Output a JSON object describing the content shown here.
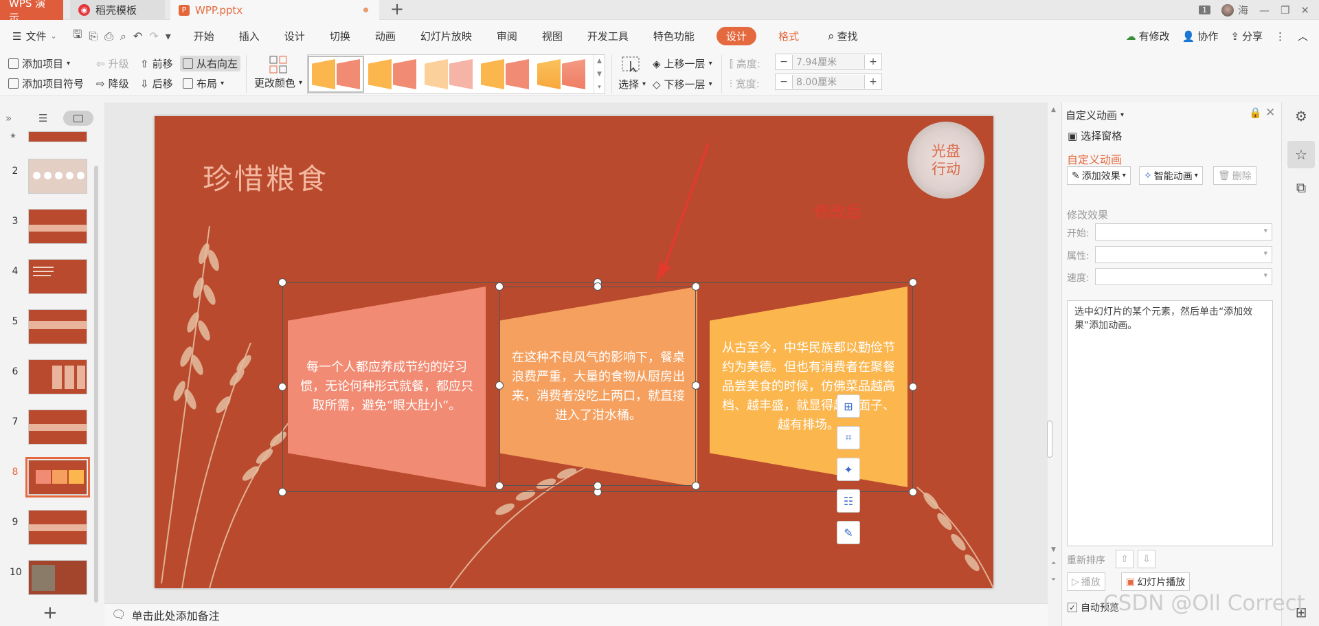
{
  "tabs": {
    "wps": "WPS 演示",
    "daoke": "稻壳模板",
    "ppt": "WPP.pptx",
    "daoke_icon": "daoke-logo-icon",
    "ppt_icon": "ppt-file-icon"
  },
  "titlebar": {
    "page_badge": "1",
    "user": "海"
  },
  "menu": {
    "file": "文件",
    "items": [
      "开始",
      "插入",
      "设计",
      "切换",
      "动画",
      "幻灯片放映",
      "审阅",
      "视图",
      "开发工具",
      "特色功能"
    ],
    "design_pill": "设计",
    "format": "格式",
    "search": "查找",
    "right": {
      "changes": "有修改",
      "collab": "协作",
      "share": "分享"
    }
  },
  "ribbon": {
    "add_item": "添加项目",
    "add_item_symbol": "添加项目符号",
    "upgrade": "升级",
    "downgrade": "降级",
    "forward": "前移",
    "backward": "后移",
    "rtl": "从右向左",
    "layout": "布局",
    "change_color": "更改颜色",
    "select": "选择",
    "up_layer": "上移一层",
    "down_layer": "下移一层",
    "height_label": "高度:",
    "height_value": "7.94厘米",
    "width_label": "宽度:",
    "width_value": "8.00厘米"
  },
  "slides": {
    "numbers": [
      "2",
      "3",
      "4",
      "5",
      "6",
      "7",
      "8",
      "9",
      "10"
    ],
    "selected": "8"
  },
  "slide": {
    "title": "珍惜粮食",
    "seal": "光盘行动",
    "annotation": "修改后",
    "box1": "每一个人都应养成节约的好习惯，无论何种形式就餐，都应只取所需，避免“眼大肚小”。",
    "box2": "在这种不良风气的影响下，餐桌浪费严重，大量的食物从厨房出来，消费者没吃上两口，就直接进入了泔水桶。",
    "box3": "从古至今，中华民族都以勤俭节约为美德。但也有消费者在聚餐品尝美食的时候，仿佛菜品越高档、越丰盛，就显得越有面子、越有排场。"
  },
  "notes": "单击此处添加备注",
  "panel": {
    "header": "自定义动画",
    "select_pane": "选择窗格",
    "section": "自定义动画",
    "add_effect": "添加效果",
    "smart_anim": "智能动画",
    "delete": "删除",
    "modify": "修改效果",
    "start": "开始:",
    "property": "属性:",
    "speed": "速度:",
    "hint": "选中幻灯片的某个元素，然后单击“添加效果”添加动画。",
    "reorder": "重新排序",
    "play": "播放",
    "slideshow": "幻灯片播放",
    "autopreview": "自动预览"
  },
  "watermark": "CSDN @Oll Correct",
  "colors": {
    "accent": "#e5693e",
    "slide_bg": "#b94a2d",
    "box1": "#f28b73",
    "box2": "#f5a05f",
    "box3": "#fbb64e",
    "annotation": "#e23a2d"
  }
}
